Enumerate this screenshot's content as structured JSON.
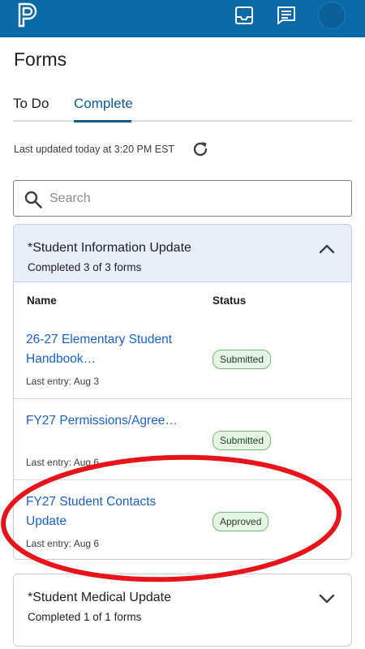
{
  "header": {
    "logo_icon": "powerschool-logo-icon",
    "icons": [
      "inbox-icon",
      "message-icon",
      "avatar"
    ],
    "bar_color": "#0a6aa8"
  },
  "page": {
    "title": "Forms"
  },
  "tabs": [
    {
      "label": "To Do",
      "active": false
    },
    {
      "label": "Complete",
      "active": true
    }
  ],
  "status": {
    "last_updated": "Last updated today at 3:20 PM EST",
    "refresh_icon": "refresh-icon"
  },
  "search": {
    "placeholder": "Search",
    "value": ""
  },
  "groups": [
    {
      "title": "*Student Information Update",
      "subtitle": "Completed 3 of 3 forms",
      "expanded": true,
      "columns": {
        "name": "Name",
        "status": "Status"
      },
      "forms": [
        {
          "name": "26-27 Elementary Student Handbook…",
          "last_entry": "Last entry: Aug 3",
          "status": "Submitted"
        },
        {
          "name": "FY27 Permissions/Agree…",
          "last_entry": "Last entry: Aug 6",
          "status": "Submitted"
        },
        {
          "name": "FY27 Student Contacts Update",
          "last_entry": "Last entry: Aug 6",
          "status": "Approved"
        }
      ]
    },
    {
      "title": "*Student Medical Update",
      "subtitle": "Completed 1 of 1 forms",
      "expanded": false
    }
  ],
  "annotation": {
    "shape": "ellipse",
    "color": "#e8141a",
    "encircles": "FY27 Student Contacts Update"
  },
  "colors": {
    "link": "#1a62c4",
    "accent": "#0b5c93",
    "badge_border": "#6fbf73",
    "badge_bg": "#e6f4e5",
    "group_header_bg": "#e8effa"
  }
}
